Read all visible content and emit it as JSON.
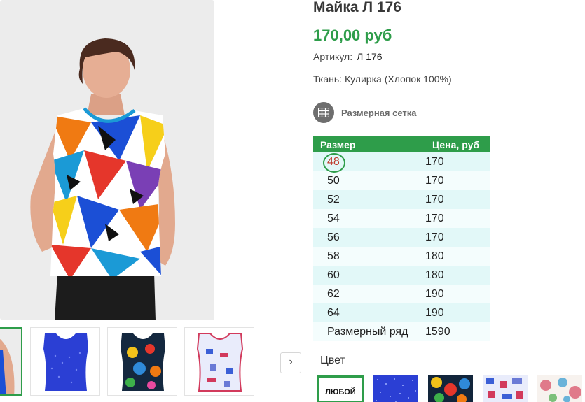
{
  "product": {
    "title": "Майка Л 176",
    "price": "170,00 руб",
    "sku_label": "Артикул:",
    "sku_value": "Л 176",
    "fabric": "Ткань: Кулирка (Хлопок 100%)",
    "size_chart_link": "Размерная сетка"
  },
  "size_table": {
    "headers": [
      "Размер",
      "Цена, руб"
    ],
    "selected_index": 0,
    "rows": [
      {
        "size": "48",
        "price": "170"
      },
      {
        "size": "50",
        "price": "170"
      },
      {
        "size": "52",
        "price": "170"
      },
      {
        "size": "54",
        "price": "170"
      },
      {
        "size": "56",
        "price": "170"
      },
      {
        "size": "58",
        "price": "180"
      },
      {
        "size": "60",
        "price": "180"
      },
      {
        "size": "62",
        "price": "190"
      },
      {
        "size": "64",
        "price": "190"
      },
      {
        "size": "Размерный ряд",
        "price": "1590"
      }
    ]
  },
  "gallery": {
    "next_icon": "chevron-right-icon",
    "next_glyph": "›",
    "thumbnails": [
      {
        "name": "thumb-main-photo",
        "active": true
      },
      {
        "name": "thumb-blue-dots",
        "active": false
      },
      {
        "name": "thumb-floral-dark",
        "active": false
      },
      {
        "name": "thumb-pattern-light",
        "active": false
      }
    ]
  },
  "colors": {
    "title": "Цвет",
    "any_label": "ЛЮБОЙ",
    "options": [
      "blue-dots",
      "dark-floral",
      "light-pattern",
      "white-floral"
    ]
  },
  "theme": {
    "accent": "#2e9d4a",
    "table_row_odd": "#e2f8f8",
    "table_row_even": "#f4fdfd",
    "selected_size_text": "#c0392b"
  },
  "icons": {
    "size_chart": "table-grid-icon"
  }
}
